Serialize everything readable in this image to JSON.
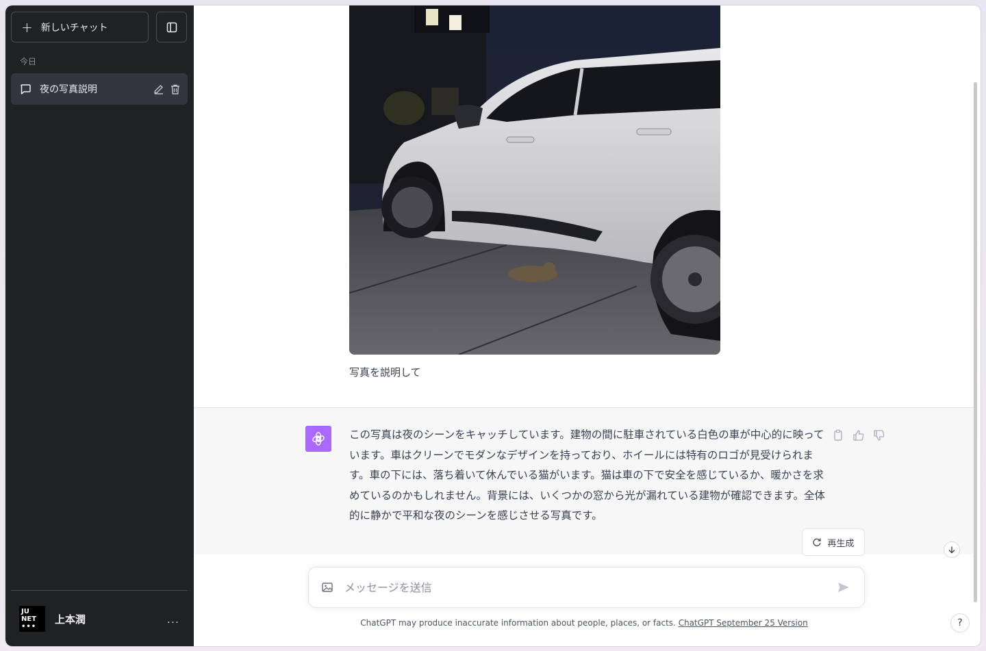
{
  "sidebar": {
    "new_chat_label": "新しいチャット",
    "section_today": "今日",
    "chats": [
      {
        "title": "夜の写真説明"
      }
    ],
    "user": {
      "name": "上本潤",
      "avatar_lines": [
        "JU",
        "NET"
      ]
    },
    "more_label": "..."
  },
  "conversation": {
    "user_message": "写真を説明して",
    "assistant_message": "この写真は夜のシーンをキャッチしています。建物の間に駐車されている白色の車が中心的に映っています。車はクリーンでモダンなデザインを持っており、ホイールには特有のロゴが見受けられます。車の下には、落ち着いて休んでいる猫がいます。猫は車の下で安全を感じているか、暖かさを求めているのかもしれません。背景には、いくつかの窓から光が漏れている建物が確認できます。全体的に静かで平和な夜のシーンを感じさせる写真です。",
    "regenerate_label": "再生成"
  },
  "composer": {
    "placeholder": "メッセージを送信"
  },
  "footer": {
    "disclaimer": "ChatGPT may produce inaccurate information about people, places, or facts. ",
    "version_link": "ChatGPT September 25 Version"
  },
  "help_label": "?",
  "colors": {
    "sidebar_bg": "#202123",
    "active_chat_bg": "#343541",
    "bot_avatar": "#ab68ff",
    "assistant_bg": "#f7f7f8"
  },
  "icons": [
    "plus-icon",
    "sidebar-toggle-icon",
    "chat-bubble-icon",
    "edit-icon",
    "trash-icon",
    "openai-logo-icon",
    "copy-icon",
    "thumbs-up-icon",
    "thumbs-down-icon",
    "refresh-icon",
    "arrow-down-icon",
    "image-icon",
    "send-icon"
  ]
}
